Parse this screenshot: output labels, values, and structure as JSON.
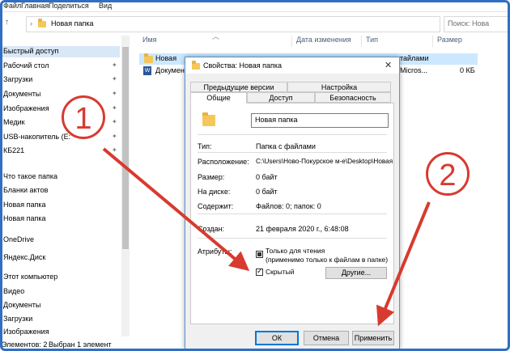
{
  "ribbon": {
    "tabs": [
      "Файл",
      "Главная",
      "Поделиться",
      "Вид"
    ]
  },
  "address": {
    "path": "Новая папка",
    "search_placeholder": "Поиск: Нова"
  },
  "sidebar": {
    "items": [
      {
        "label": "Быстрый доступ"
      },
      {
        "label": "Рабочий стол"
      },
      {
        "label": "Загрузки"
      },
      {
        "label": "Документы"
      },
      {
        "label": "Изображения"
      },
      {
        "label": "Медик"
      },
      {
        "label": "USB-накопитель (E:"
      },
      {
        "label": "КБ221"
      },
      {
        "label": "Что такое папка"
      },
      {
        "label": "Бланки актов"
      },
      {
        "label": "Новая папка"
      },
      {
        "label": "Новая папка"
      },
      {
        "label": "OneDrive"
      },
      {
        "label": "Яндекс.Диск"
      },
      {
        "label": "Этот компьютер"
      },
      {
        "label": "Видео"
      },
      {
        "label": "Документы"
      },
      {
        "label": "Загрузки"
      },
      {
        "label": "Изображения"
      }
    ]
  },
  "columns": {
    "name": "Имя",
    "date": "Дата изменения",
    "type": "Тип",
    "size": "Размер"
  },
  "files": [
    {
      "name": "Новая",
      "date": "",
      "type": "тайлами",
      "size": ""
    },
    {
      "name": "Докумен",
      "date": "",
      "type": "Micros...",
      "size": "0 КБ"
    }
  ],
  "status": {
    "count": "Элементов: 2",
    "selected": "Выбран 1 элемент"
  },
  "dialog": {
    "title": "Свойства: Новая папка",
    "close": "✕",
    "tabs_top": [
      "Предыдущие версии",
      "Настройка"
    ],
    "tabs_bottom": [
      "Общие",
      "Доступ",
      "Безопасность"
    ],
    "folder_name": "Новая папка",
    "props": {
      "type_label": "Тип:",
      "type_value": "Папка с файлами",
      "location_label": "Расположение:",
      "location_value": "C:\\Users\\Ново-Покурское м-е\\Desktop\\Новая",
      "size_label": "Размер:",
      "size_value": "0 байт",
      "disk_label": "На диске:",
      "disk_value": "0 байт",
      "contains_label": "Содержит:",
      "contains_value": "Файлов: 0; папок: 0",
      "created_label": "Создан:",
      "created_value": "21 февраля 2020 г., 6:48:08",
      "attributes_label": "Атрибуты:"
    },
    "readonly_label": "Только для чтения",
    "readonly_note": "(применимо только к файлам в папке)",
    "hidden_label": "Скрытый",
    "other_button": "Другие...",
    "ok_button": "ОК",
    "cancel_button": "Отмена",
    "apply_button": "Применить"
  },
  "callouts": {
    "one": "1",
    "two": "2"
  },
  "colors": {
    "accent": "#0078d7",
    "annotation": "#d83a2f",
    "frame": "#2f6fc4",
    "folder": "#f5c75a"
  }
}
